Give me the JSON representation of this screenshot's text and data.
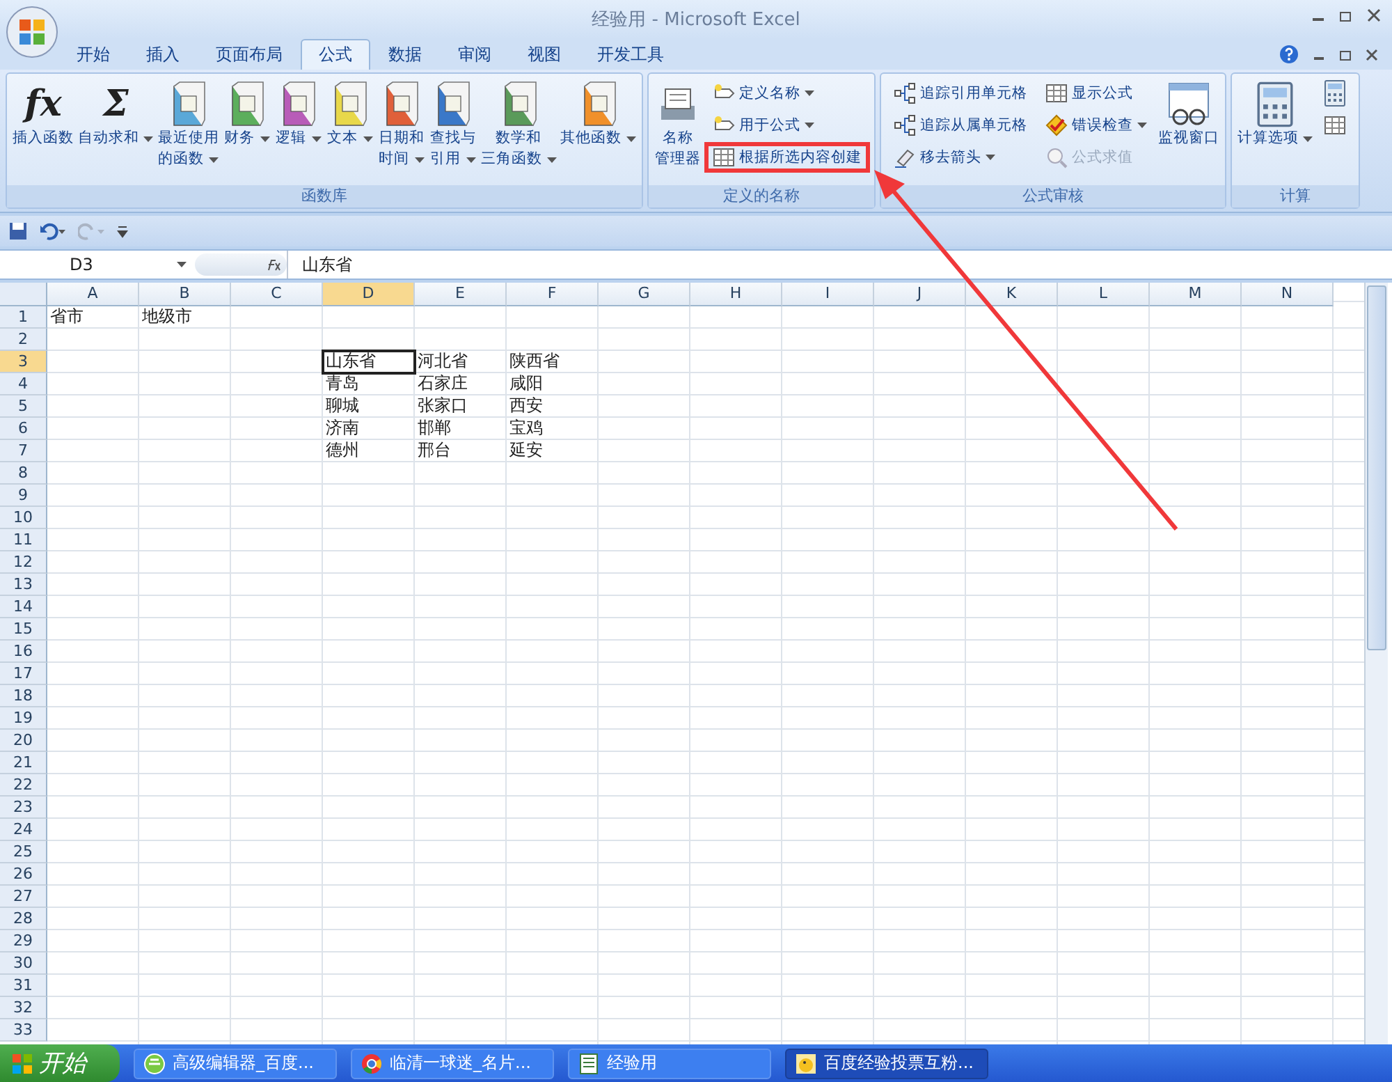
{
  "window": {
    "title": "经验用 - Microsoft Excel"
  },
  "tabs": [
    {
      "label": "开始",
      "selected": false
    },
    {
      "label": "插入",
      "selected": false
    },
    {
      "label": "页面布局",
      "selected": false
    },
    {
      "label": "公式",
      "selected": true
    },
    {
      "label": "数据",
      "selected": false
    },
    {
      "label": "审阅",
      "selected": false
    },
    {
      "label": "视图",
      "selected": false
    },
    {
      "label": "开发工具",
      "selected": false
    }
  ],
  "ribbon": {
    "groups": [
      {
        "label": "函数库",
        "items": [
          {
            "kind": "big",
            "glyph": "fx",
            "lines": [
              "插入函数"
            ],
            "dropdown": false
          },
          {
            "kind": "big",
            "glyph": "Σ",
            "lines": [
              "自动求和"
            ],
            "dropdown": true
          },
          {
            "kind": "big",
            "lines": [
              "最近使用",
              "的函数"
            ],
            "dropdown": true
          },
          {
            "kind": "big",
            "lines": [
              "财务"
            ],
            "dropdown": true
          },
          {
            "kind": "big",
            "lines": [
              "逻辑"
            ],
            "dropdown": true
          },
          {
            "kind": "big",
            "lines": [
              "文本"
            ],
            "dropdown": true
          },
          {
            "kind": "big",
            "lines": [
              "日期和",
              "时间"
            ],
            "dropdown": true
          },
          {
            "kind": "big",
            "lines": [
              "查找与",
              "引用"
            ],
            "dropdown": true
          },
          {
            "kind": "big",
            "lines": [
              "数学和",
              "三角函数"
            ],
            "dropdown": true
          },
          {
            "kind": "big",
            "lines": [
              "其他函数"
            ],
            "dropdown": true
          }
        ]
      },
      {
        "label": "定义的名称",
        "items": [
          {
            "kind": "big",
            "lines": [
              "名称",
              "管理器"
            ],
            "dropdown": false
          },
          {
            "kind": "small",
            "label": "定义名称",
            "dropdown": true,
            "disabled": false,
            "highlighted": false
          },
          {
            "kind": "small",
            "label": "用于公式",
            "dropdown": true,
            "disabled": false,
            "highlighted": false
          },
          {
            "kind": "small",
            "label": "根据所选内容创建",
            "dropdown": false,
            "disabled": false,
            "highlighted": true
          }
        ]
      },
      {
        "label": "公式审核",
        "items": [
          {
            "kind": "small",
            "label": "追踪引用单元格",
            "dropdown": false,
            "disabled": false,
            "highlighted": false
          },
          {
            "kind": "small",
            "label": "追踪从属单元格",
            "dropdown": false,
            "disabled": false,
            "highlighted": false
          },
          {
            "kind": "small",
            "label": "移去箭头",
            "dropdown": true,
            "disabled": false,
            "highlighted": false
          },
          {
            "kind": "small",
            "label": "显示公式",
            "dropdown": false,
            "disabled": false,
            "highlighted": false
          },
          {
            "kind": "small",
            "label": "错误检查",
            "dropdown": true,
            "disabled": false,
            "highlighted": false
          },
          {
            "kind": "small",
            "label": "公式求值",
            "dropdown": false,
            "disabled": true,
            "highlighted": false
          },
          {
            "kind": "big",
            "lines": [
              "监视窗口"
            ],
            "dropdown": false
          }
        ]
      },
      {
        "label": "计算",
        "items": [
          {
            "kind": "big",
            "lines": [
              "计算选项"
            ],
            "dropdown": true
          },
          {
            "kind": "iconsmall"
          },
          {
            "kind": "iconsmall"
          }
        ]
      }
    ]
  },
  "name_box": {
    "value": "D3"
  },
  "formula_bar": {
    "value": "山东省"
  },
  "columns": [
    {
      "label": "A",
      "selected": false
    },
    {
      "label": "B",
      "selected": false
    },
    {
      "label": "C",
      "selected": false
    },
    {
      "label": "D",
      "selected": true
    },
    {
      "label": "E",
      "selected": false
    },
    {
      "label": "F",
      "selected": false
    },
    {
      "label": "G",
      "selected": false
    },
    {
      "label": "H",
      "selected": false
    },
    {
      "label": "I",
      "selected": false
    },
    {
      "label": "J",
      "selected": false
    },
    {
      "label": "K",
      "selected": false
    },
    {
      "label": "L",
      "selected": false
    },
    {
      "label": "M",
      "selected": false
    },
    {
      "label": "N",
      "selected": false
    }
  ],
  "rows": [
    {
      "number": "1",
      "selected": false,
      "cells": [
        "省市",
        "地级市"
      ]
    },
    {
      "number": "2",
      "selected": false
    },
    {
      "number": "3",
      "selected": true,
      "cells": [
        null,
        null,
        null,
        "山东省",
        "河北省",
        "陕西省"
      ]
    },
    {
      "number": "4",
      "selected": false,
      "cells": [
        null,
        null,
        null,
        "青岛",
        "石家庄",
        "咸阳"
      ]
    },
    {
      "number": "5",
      "selected": false,
      "cells": [
        null,
        null,
        null,
        "聊城",
        "张家口",
        "西安"
      ]
    },
    {
      "number": "6",
      "selected": false,
      "cells": [
        null,
        null,
        null,
        "济南",
        "邯郸",
        "宝鸡"
      ]
    },
    {
      "number": "7",
      "selected": false,
      "cells": [
        null,
        null,
        null,
        "德州",
        "邢台",
        "延安"
      ]
    },
    {
      "number": "8",
      "selected": false
    },
    {
      "number": "9",
      "selected": false
    },
    {
      "number": "10",
      "selected": false
    },
    {
      "number": "11",
      "selected": false
    },
    {
      "number": "12",
      "selected": false
    },
    {
      "number": "13",
      "selected": false
    },
    {
      "number": "14",
      "selected": false
    },
    {
      "number": "15",
      "selected": false
    },
    {
      "number": "16",
      "selected": false
    },
    {
      "number": "17",
      "selected": false
    },
    {
      "number": "18",
      "selected": false
    },
    {
      "number": "19",
      "selected": false
    },
    {
      "number": "20",
      "selected": false
    },
    {
      "number": "21",
      "selected": false
    },
    {
      "number": "22",
      "selected": false
    },
    {
      "number": "23",
      "selected": false
    },
    {
      "number": "24",
      "selected": false
    },
    {
      "number": "25",
      "selected": false
    },
    {
      "number": "26",
      "selected": false
    },
    {
      "number": "27",
      "selected": false
    },
    {
      "number": "28",
      "selected": false
    },
    {
      "number": "29",
      "selected": false
    },
    {
      "number": "30",
      "selected": false
    },
    {
      "number": "31",
      "selected": false
    },
    {
      "number": "32",
      "selected": false
    },
    {
      "number": "33",
      "selected": false
    }
  ],
  "taskbar": {
    "start": "开始",
    "tasks": [
      {
        "label": "高级编辑器_百度...",
        "selected": false
      },
      {
        "label": "临清一球迷_名片...",
        "selected": false
      },
      {
        "label": "经验用",
        "selected": false
      },
      {
        "label": "百度经验投票互粉...",
        "selected": true
      }
    ]
  }
}
